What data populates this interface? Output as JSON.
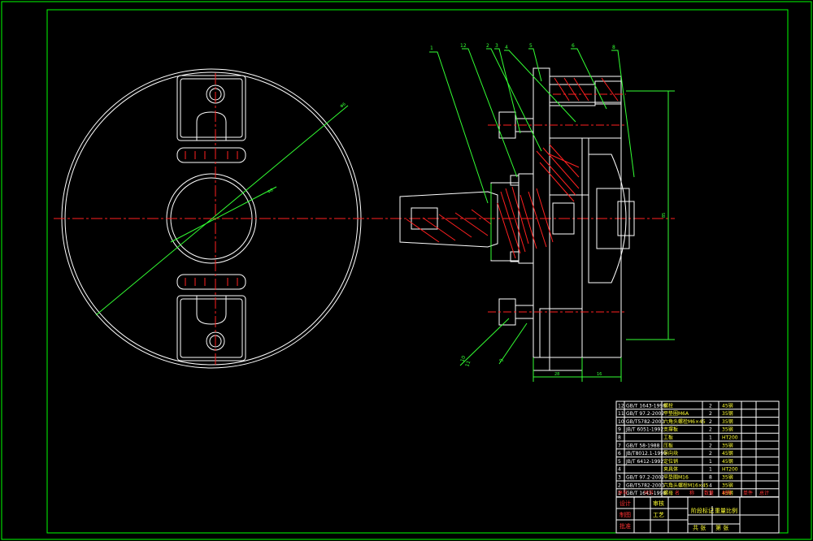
{
  "colors": {
    "background": "#000000",
    "frame": "#00ff00",
    "outline": "#ffffff",
    "centerline": "#ff2020",
    "dimension": "#33ff33",
    "section_hatch": "#ff2020",
    "text_yellow": "#ffff33"
  },
  "balloons": {
    "top": [
      "1",
      "12",
      "2",
      "3",
      "4",
      "5",
      "6",
      "8"
    ],
    "bottom": [
      "10",
      "11",
      "9"
    ]
  },
  "dimensions": {
    "front_diameter": "Φ6",
    "bore_diameter": "Φ8",
    "height": "85",
    "bottom_left": "28",
    "bottom_right": "16"
  },
  "bom": {
    "rows": [
      {
        "no": "12",
        "std": "GB/T 1643-1998",
        "name": "螺栓",
        "qty": "2",
        "mat": "45钢"
      },
      {
        "no": "11",
        "std": "GB/T 97.2-2002",
        "name": "平垫圈M6A",
        "qty": "2",
        "mat": "35钢"
      },
      {
        "no": "10",
        "std": "GB/T5782-2000",
        "name": "六角头螺栓M6×45",
        "qty": "2",
        "mat": "35钢"
      },
      {
        "no": "9",
        "std": "JB/T 6051-1992",
        "name": "支撑板",
        "qty": "2",
        "mat": "35钢"
      },
      {
        "no": "8",
        "std": "",
        "name": "工板",
        "qty": "1",
        "mat": "HT200"
      },
      {
        "no": "7",
        "std": "GB/T 58-1988",
        "name": "压板",
        "qty": "2",
        "mat": "35钢"
      },
      {
        "no": "6",
        "std": "JB/T8012.1-1999",
        "name": "导向块",
        "qty": "2",
        "mat": "45钢"
      },
      {
        "no": "5",
        "std": "JB/T 6412-1992",
        "name": "定位销",
        "qty": "1",
        "mat": "45钢"
      },
      {
        "no": "4",
        "std": "",
        "name": "夹具体",
        "qty": "1",
        "mat": "HT200"
      },
      {
        "no": "3",
        "std": "GB/T 97.2-2002",
        "name": "平垫圈M16",
        "qty": "8",
        "mat": "35钢"
      },
      {
        "no": "2",
        "std": "GB/T5782-2000",
        "name": "六角头螺栓M16×45",
        "qty": "4",
        "mat": "35钢"
      },
      {
        "no": "1",
        "std": "GB/T 1643-1998",
        "name": "螺母",
        "qty": "1",
        "mat": "45钢"
      }
    ],
    "header": [
      "序号",
      "代号",
      "名",
      "称",
      "数量",
      "材料",
      "单件",
      "总计"
    ]
  },
  "title_block": {
    "design": "设计",
    "check": "审核",
    "draw": "制图",
    "approve": "批准",
    "process": "工艺",
    "stage": "阶段标记",
    "weight": "重量",
    "scale": "比例",
    "sheets": "共 张",
    "sheet": "第 张"
  }
}
